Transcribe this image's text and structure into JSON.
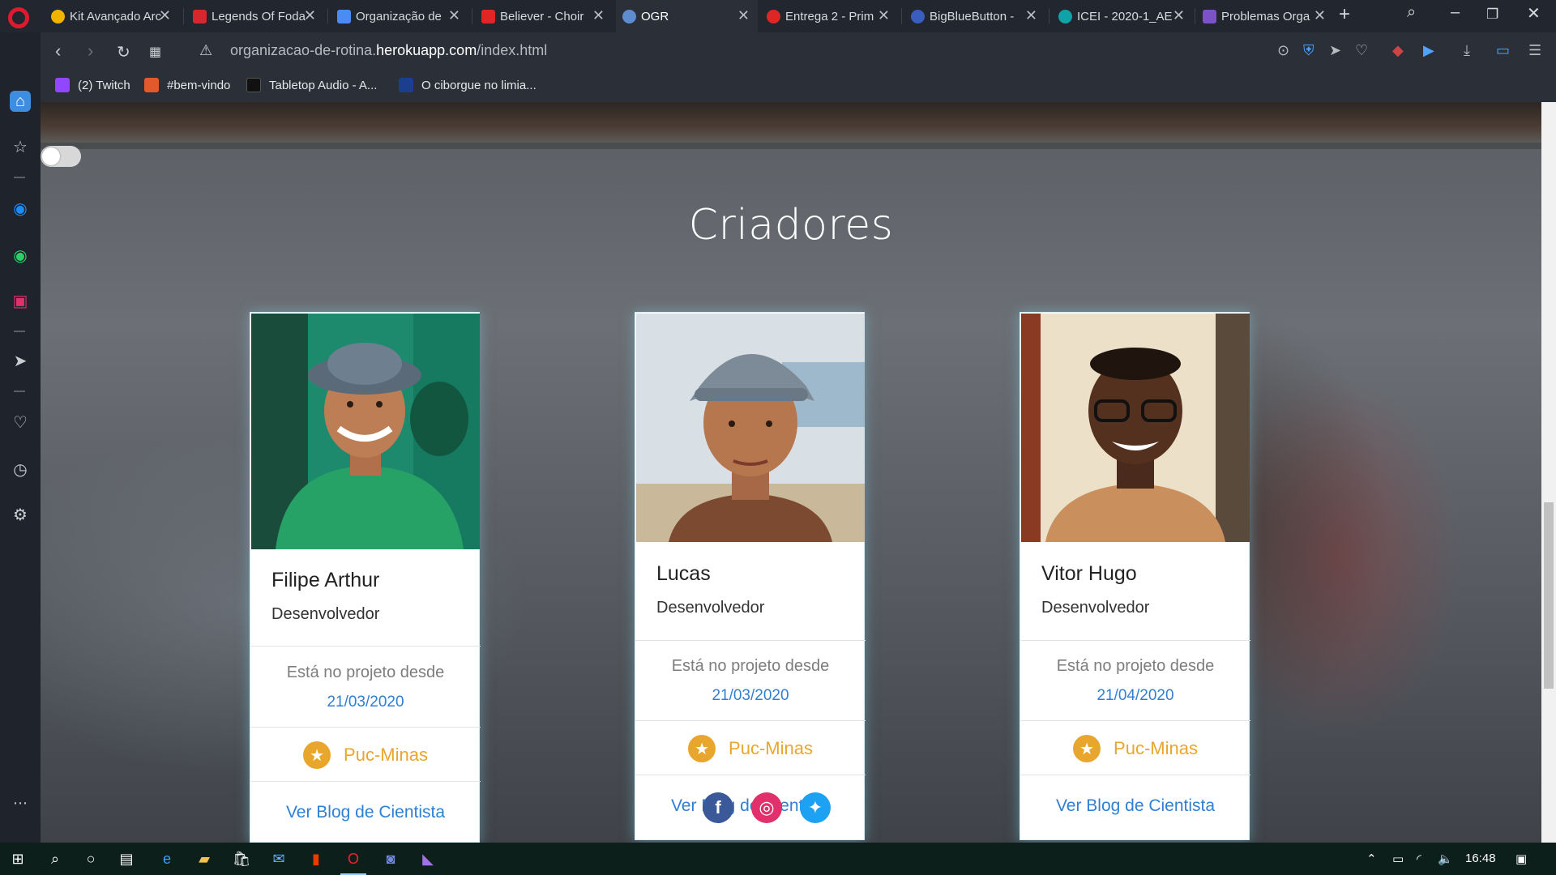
{
  "browser": {
    "tabs": [
      {
        "title": "Kit Avançado Arc",
        "fav_color": "#f0b400",
        "active": false
      },
      {
        "title": "Legends Of Foda",
        "fav_color": "#d7262c",
        "active": false
      },
      {
        "title": "Organização de",
        "fav_color": "#4b8bf4",
        "active": false
      },
      {
        "title": "Believer - Choir",
        "fav_color": "#e02525",
        "active": false
      },
      {
        "title": "OGR",
        "fav_color": "#5e8ccf",
        "active": true
      },
      {
        "title": "Entrega 2 - Prim",
        "fav_color": "#e02525",
        "active": false
      },
      {
        "title": "BigBlueButton -",
        "fav_color": "#3a5ebf",
        "active": false
      },
      {
        "title": "ICEI - 2020-1_AE",
        "fav_color": "#0fa3a8",
        "active": false
      },
      {
        "title": "Problemas Orga",
        "fav_color": "#7b52c7",
        "active": false
      }
    ],
    "address": {
      "prefix": "organizacao-de-rotina.",
      "domain": "herokuapp.com",
      "path": "/index.html"
    },
    "bookmarks": [
      {
        "label": "(2) Twitch",
        "fav_color": "#9146ff"
      },
      {
        "label": "#bem-vindo",
        "fav_color": "#e25a2c"
      },
      {
        "label": "Tabletop Audio - A...",
        "fav_color": "#111111"
      },
      {
        "label": "O ciborgue no limia...",
        "fav_color": "#1c3e8f"
      }
    ]
  },
  "page": {
    "title": "Criadores",
    "creators": [
      {
        "name": "Filipe Arthur",
        "role": "Desenvolvedor",
        "since_label": "Está no projeto desde",
        "since_date": "21/03/2020",
        "institution": "Puc-Minas",
        "blog_label": "Ver Blog de Cientista"
      },
      {
        "name": "Lucas",
        "role": "Desenvolvedor",
        "since_label": "Está no projeto desde",
        "since_date": "21/03/2020",
        "institution": "Puc-Minas",
        "blog_label": "Ver Blog de Cientista"
      },
      {
        "name": "Vitor Hugo",
        "role": "Desenvolvedor",
        "since_label": "Está no projeto desde",
        "since_date": "21/04/2020",
        "institution": "Puc-Minas",
        "blog_label": "Ver Blog de Cientista"
      }
    ],
    "social_icons": [
      "facebook-icon",
      "instagram-icon",
      "twitter-icon"
    ]
  },
  "taskbar": {
    "time": "16:48"
  },
  "colors": {
    "accent_blue": "#2f7fd3",
    "accent_gold": "#e8a72c",
    "opera_red": "#e0192f"
  }
}
